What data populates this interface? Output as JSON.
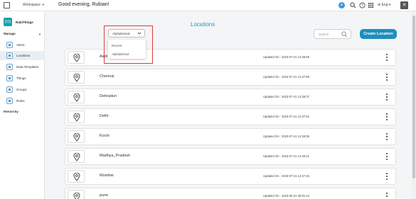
{
  "topbar": {
    "workspace_label": "Workspace",
    "greeting": "Good evening, Rubian!",
    "language": "Eng"
  },
  "sidebar": {
    "brand": "RubiThings",
    "manage_label": "Manage",
    "hierarchy_label": "Hierarchy",
    "items": [
      {
        "label": "Alerts",
        "icon": "alert-icon"
      },
      {
        "label": "Locations",
        "icon": "location-icon"
      },
      {
        "label": "Data Templates",
        "icon": "template-icon"
      },
      {
        "label": "Things",
        "icon": "things-icon"
      },
      {
        "label": "Groups",
        "icon": "groups-icon"
      },
      {
        "label": "Rules",
        "icon": "rules-icon"
      }
    ],
    "active_index": 1
  },
  "main": {
    "title": "Locations",
    "search_placeholder": "Search",
    "create_label": "Create Location",
    "sort": {
      "selected": "Alphabetical",
      "options": [
        "Recent",
        "Alphabetical"
      ]
    },
    "locations": [
      {
        "name": "Aadi",
        "updated": "Updated On : 2023-07-21 12:28:59"
      },
      {
        "name": "Chennai",
        "updated": "Updated On : 2023-07-21 12:27:56"
      },
      {
        "name": "Dehradun",
        "updated": "Updated On : 2023-07-21 12:28:37"
      },
      {
        "name": "Delhi",
        "updated": "Updated On : 2023-07-21 12:27:51"
      },
      {
        "name": "Kochi",
        "updated": "Updated On : 2023-07-21 12:28:08"
      },
      {
        "name": "Madhya_Pradesh",
        "updated": "Updated On : 2023-07-21 12:29:21"
      },
      {
        "name": "Mumbai",
        "updated": "Updated On : 2023-07-21 12:27:45"
      },
      {
        "name": "pune",
        "updated": "Updated On : 2023-06-21 06:01:44"
      }
    ]
  },
  "colors": {
    "accent": "#1d8fbf",
    "title": "#2f8fc0",
    "highlight_outline": "#e03a3a",
    "brand": "#1aa0a8"
  }
}
